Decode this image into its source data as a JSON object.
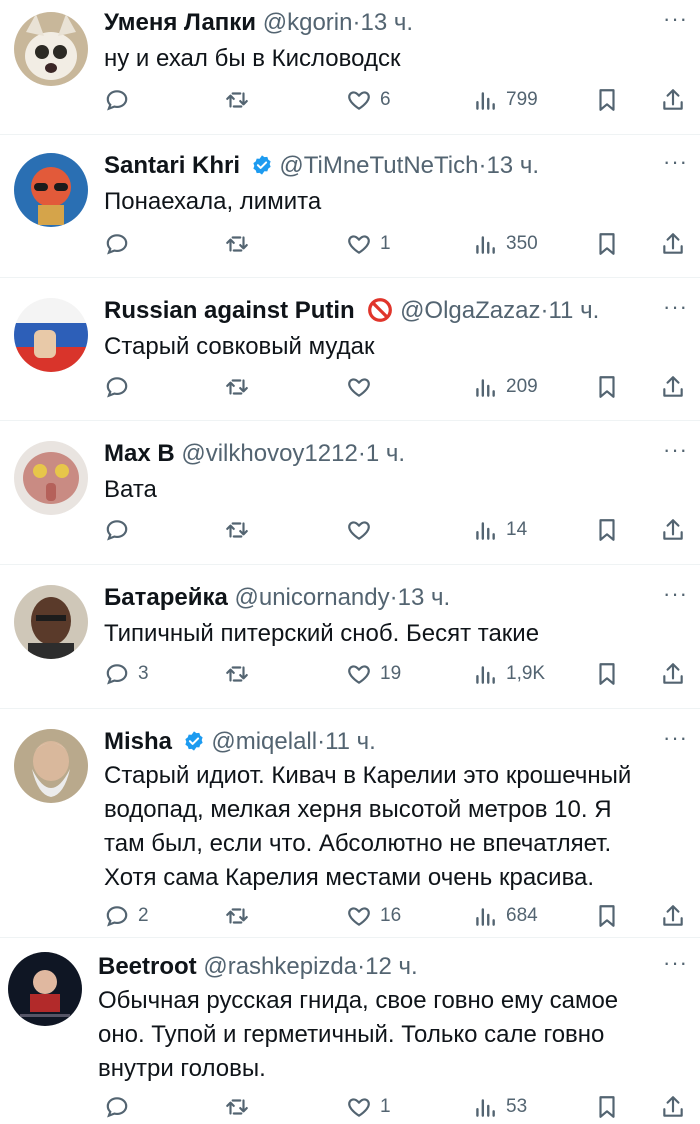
{
  "tweets": [
    {
      "name": "Уменя Лапки",
      "handle": "@kgorin",
      "time": "13 ч.",
      "verified": false,
      "badge": "",
      "lines": [
        "ну и ехал бы в Кисловодск"
      ],
      "replies": "",
      "likes": "6",
      "views": "799"
    },
    {
      "name": "Santari Khri",
      "handle": "@TiMneTutNeTich",
      "time": "13 ч.",
      "verified": true,
      "badge": "",
      "lines": [
        "Понаехала, лимита"
      ],
      "replies": "",
      "likes": "1",
      "views": "350"
    },
    {
      "name": "Russian against Putin",
      "handle": "@OlgaZazaz",
      "time": "11 ч.",
      "verified": false,
      "badge": "no-entry-emoji",
      "lines": [
        "Старый совковый мудак"
      ],
      "replies": "",
      "likes": "",
      "views": "209"
    },
    {
      "name": "Max B",
      "handle": "@vilkhovoy1212",
      "time": "1 ч.",
      "verified": false,
      "badge": "",
      "lines": [
        "Вата"
      ],
      "replies": "",
      "likes": "",
      "views": "14"
    },
    {
      "name": "Батарейка",
      "handle": "@unicornandy",
      "time": "13 ч.",
      "verified": false,
      "badge": "",
      "lines": [
        "Типичный питерский сноб. Бесят такие"
      ],
      "replies": "3",
      "likes": "19",
      "views": "1,9K"
    },
    {
      "name": "Misha",
      "handle": "@miqelall",
      "time": "11 ч.",
      "verified": true,
      "badge": "",
      "lines": [
        "Старый идиот. Кивач в Карелии это крошечный",
        "водопад, мелкая херня высотой метров 10. Я",
        "там был, если что. Абсолютно не впечатляет.",
        "Хотя сама Карелия местами очень красива."
      ],
      "replies": "2",
      "likes": "16",
      "views": "684"
    },
    {
      "name": "Beetroot",
      "handle": "@rashkepizda",
      "time": "12 ч.",
      "verified": false,
      "badge": "",
      "lines": [
        "Обычная русская гнида, свое говно ему самое",
        "оно. Тупой и герметичный. Только сале говно",
        "внутри головы."
      ],
      "replies": "",
      "likes": "1",
      "views": "53"
    }
  ],
  "dot": "·",
  "more_label": "···",
  "colors": {
    "text": "#0f1419",
    "muted": "#536471",
    "verified": "#1d9bf0",
    "separator": "#eff3f4"
  }
}
